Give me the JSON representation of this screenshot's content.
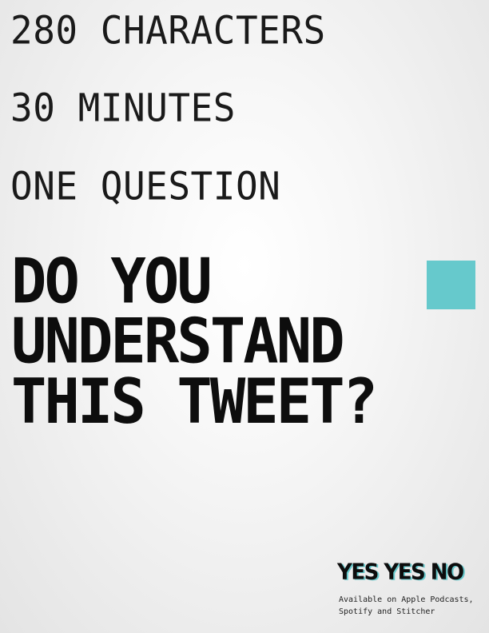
{
  "taglines": [
    "280 CHARACTERS",
    "30 MINUTES",
    "ONE QUESTION"
  ],
  "headline": [
    "DO YOU",
    "UNDERSTAND",
    "THIS TWEET?"
  ],
  "brand": {
    "name": "YES YES NO",
    "availability_line1": "Available on Apple Podcasts,",
    "availability_line2": "Spotify and Stitcher"
  },
  "colors": {
    "accent": "#66c9cc",
    "text": "#111111",
    "background": "#f4f4f4"
  }
}
